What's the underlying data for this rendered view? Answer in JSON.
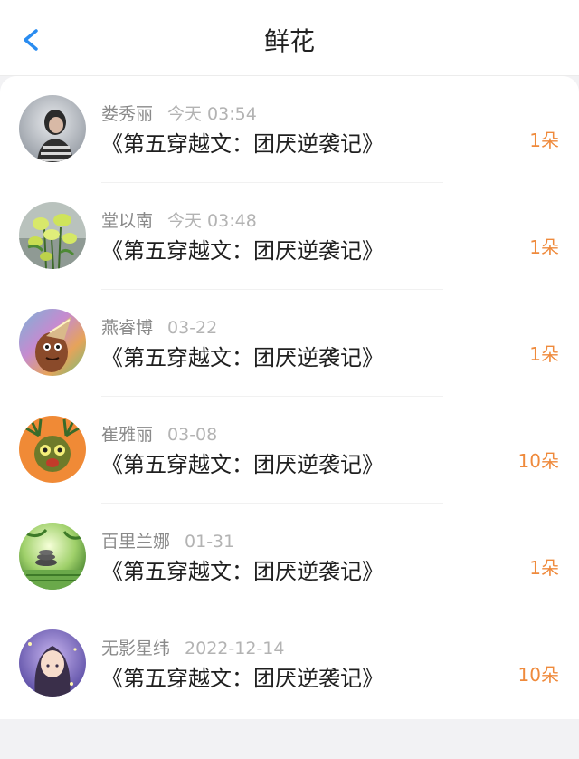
{
  "header": {
    "title": "鲜花",
    "back_icon": "chevron-left-icon",
    "accent_color": "#2a8cf0"
  },
  "list": {
    "count_color": "#ef8a3c",
    "items": [
      {
        "name": "娄秀丽",
        "time": "今天 03:54",
        "book": "《第五穿越文：团厌逆袭记》",
        "count": "1朵"
      },
      {
        "name": "堂以南",
        "time": "今天 03:48",
        "book": "《第五穿越文：团厌逆袭记》",
        "count": "1朵"
      },
      {
        "name": "燕睿博",
        "time": "03-22",
        "book": "《第五穿越文：团厌逆袭记》",
        "count": "1朵"
      },
      {
        "name": "崔雅丽",
        "time": "03-08",
        "book": "《第五穿越文：团厌逆袭记》",
        "count": "10朵"
      },
      {
        "name": "百里兰娜",
        "time": "01-31",
        "book": "《第五穿越文：团厌逆袭记》",
        "count": "1朵"
      },
      {
        "name": "无影星纬",
        "time": "2022-12-14",
        "book": "《第五穿越文：团厌逆袭记》",
        "count": "10朵"
      }
    ]
  }
}
